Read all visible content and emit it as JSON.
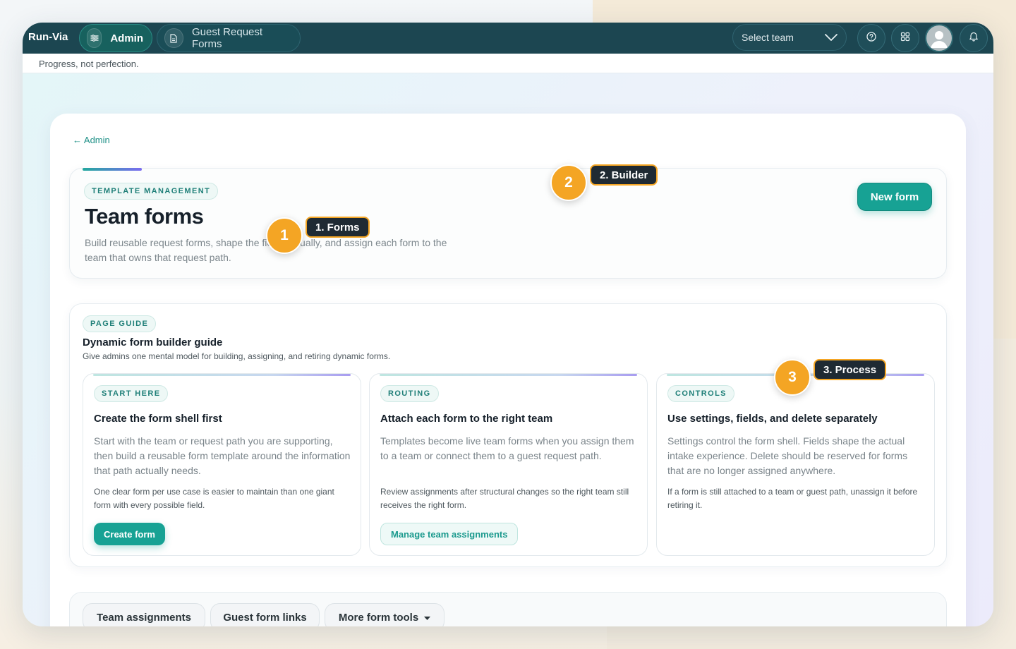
{
  "app": {
    "brand": "Run-Via",
    "admin_pill": "Admin",
    "guest_pill": "Guest Request Forms",
    "team_select_placeholder": "Select team",
    "tagline": "Progress, not perfection."
  },
  "icons": {
    "admin": "sliders-icon",
    "guest": "document-icon",
    "help": "question-icon",
    "apps": "grid-icon",
    "notifications": "bell-icon",
    "avatar": "user-avatar"
  },
  "back_link": "← Admin",
  "hero": {
    "chip": "TEMPLATE MANAGEMENT",
    "title": "Team forms",
    "description": "Build reusable request forms, shape the fields visually, and assign each form to the team that owns that request path.",
    "new_form": "New form"
  },
  "guide": {
    "chip": "PAGE GUIDE",
    "title": "Dynamic form builder guide",
    "subtitle": "Give admins one mental model for building, assigning, and retiring dynamic forms.",
    "cards": [
      {
        "chip": "START HERE",
        "title": "Create the form shell first",
        "body": "Start with the team or request path you are supporting, then build a reusable form template around the information that path actually needs.",
        "note": "One clear form per use case is easier to maintain than one giant form with every possible field.",
        "button": "Create form"
      },
      {
        "chip": "ROUTING",
        "title": "Attach each form to the right team",
        "body": "Templates become live team forms when you assign them to a team or connect them to a guest request path.",
        "note": "Review assignments after structural changes so the right team still receives the right form.",
        "button": "Manage team assignments"
      },
      {
        "chip": "CONTROLS",
        "title": "Use settings, fields, and delete separately",
        "body": "Settings control the form shell. Fields shape the actual intake experience. Delete should be reserved for forms that are no longer assigned anywhere.",
        "note": "If a form is still attached to a team or guest path, unassign it before retiring it."
      }
    ]
  },
  "tools": {
    "team_assignments": "Team assignments",
    "guest_form_links": "Guest form links",
    "more_tools": "More form tools"
  },
  "callouts": [
    {
      "number": "1",
      "label": "1. Forms"
    },
    {
      "number": "2",
      "label": "2. Builder"
    },
    {
      "number": "3",
      "label": "3. Process"
    }
  ],
  "colors": {
    "topbar": "#1c4651",
    "accent": "#17a294",
    "marker": "#f4a524"
  }
}
